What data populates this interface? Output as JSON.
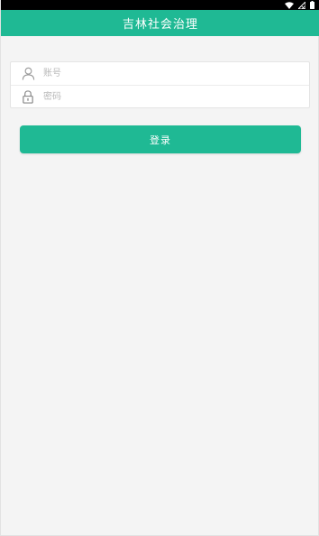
{
  "status_bar": {
    "icons": [
      "wifi-icon",
      "signal-icon",
      "battery-icon"
    ],
    "background": "#000000"
  },
  "header": {
    "title": "吉林社会治理",
    "background": "#1fb994"
  },
  "login_form": {
    "account": {
      "placeholder": "账号",
      "icon": "user-icon"
    },
    "password": {
      "placeholder": "密码",
      "icon": "lock-icon"
    }
  },
  "login_button": {
    "label": "登录",
    "color": "#1fb994"
  }
}
